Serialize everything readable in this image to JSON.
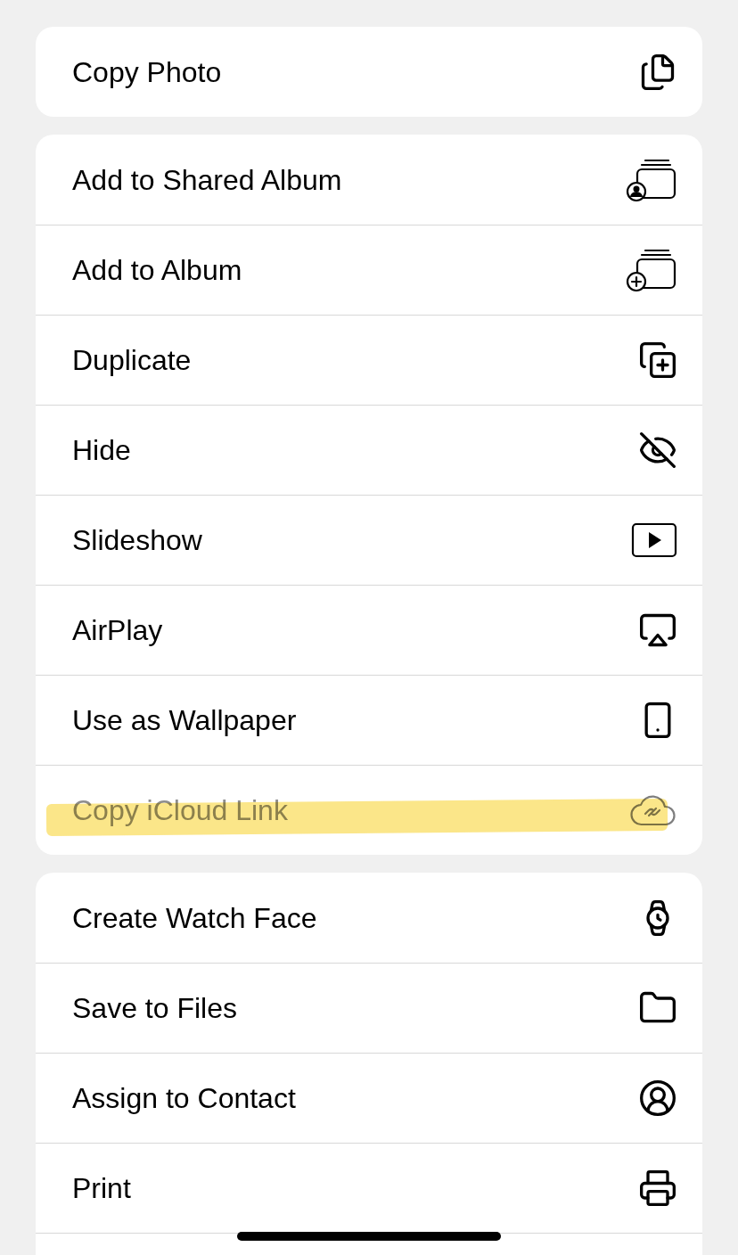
{
  "groups": [
    {
      "items": [
        {
          "label": "Copy Photo",
          "disabled": false,
          "highlighted": false
        }
      ]
    },
    {
      "items": [
        {
          "label": "Add to Shared Album",
          "disabled": false,
          "highlighted": false
        },
        {
          "label": "Add to Album",
          "disabled": false,
          "highlighted": false
        },
        {
          "label": "Duplicate",
          "disabled": false,
          "highlighted": false
        },
        {
          "label": "Hide",
          "disabled": false,
          "highlighted": false
        },
        {
          "label": "Slideshow",
          "disabled": false,
          "highlighted": false
        },
        {
          "label": "AirPlay",
          "disabled": false,
          "highlighted": false
        },
        {
          "label": "Use as Wallpaper",
          "disabled": false,
          "highlighted": false
        },
        {
          "label": "Copy iCloud Link",
          "disabled": true,
          "highlighted": true
        }
      ]
    },
    {
      "items": [
        {
          "label": "Create Watch Face",
          "disabled": false,
          "highlighted": false
        },
        {
          "label": "Save to Files",
          "disabled": false,
          "highlighted": false
        },
        {
          "label": "Assign to Contact",
          "disabled": false,
          "highlighted": false
        },
        {
          "label": "Print",
          "disabled": false,
          "highlighted": false
        }
      ],
      "more_below": true
    }
  ]
}
